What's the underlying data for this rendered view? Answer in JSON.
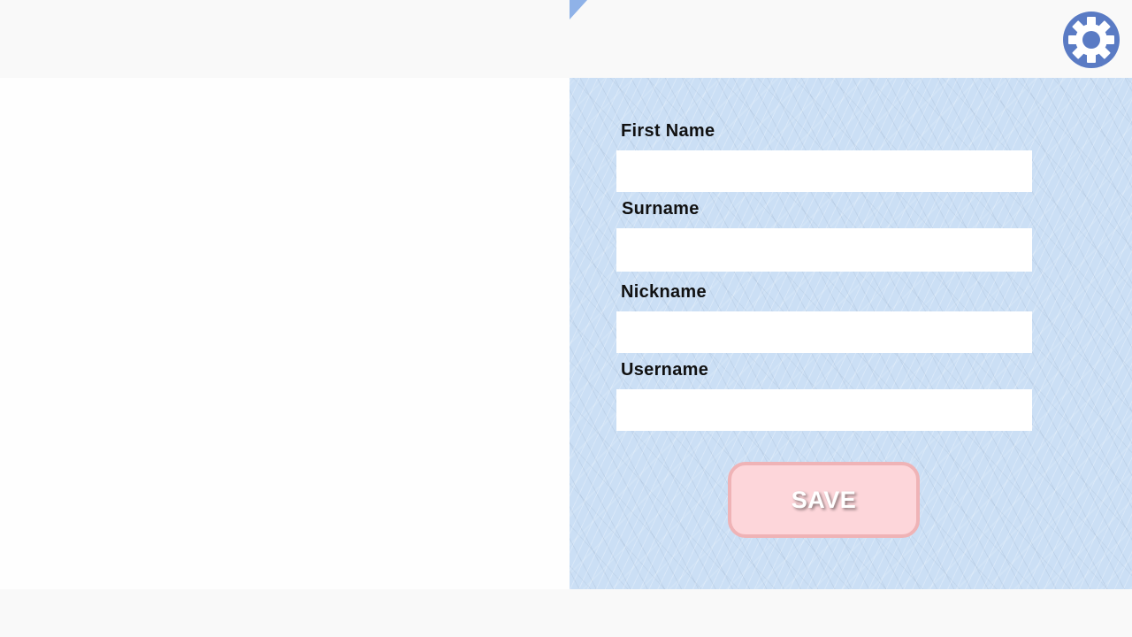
{
  "header": {
    "settings_icon": "gear-icon"
  },
  "form": {
    "fields": [
      {
        "label": "First Name",
        "value": "",
        "placeholder": ""
      },
      {
        "label": "Surname",
        "value": "",
        "placeholder": ""
      },
      {
        "label": "Nickname",
        "value": "",
        "placeholder": ""
      },
      {
        "label": "Username",
        "value": "",
        "placeholder": ""
      }
    ],
    "save_label": "SAVE"
  },
  "colors": {
    "background": "#f9f9f9",
    "panel": "#cbdff5",
    "accent": "#5a7bc4",
    "save_fill": "#fdd6da",
    "save_border": "#efb3b6"
  }
}
